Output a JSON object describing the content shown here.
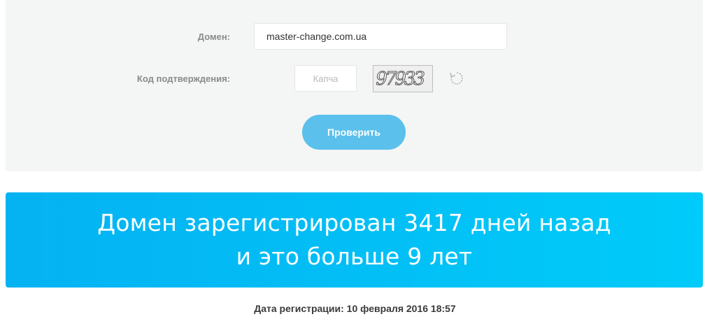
{
  "form": {
    "domain_label": "Домен:",
    "domain_value": "master-change.com.ua",
    "code_label": "Код подтверждения:",
    "captcha_placeholder": "Капча",
    "captcha_image_text": "97933",
    "refresh_icon": "refresh-icon",
    "submit_label": "Проверить"
  },
  "result": {
    "line1": "Домен зарегистрирован 3417 дней назад",
    "line2": "и это больше 9 лет",
    "registration_date": "Дата регистрации: 10 февраля 2016 18:57"
  },
  "colors": {
    "panel_bg": "#f4f5f5",
    "button": "#5bc0eb",
    "banner_from": "#05b2f2",
    "banner_to": "#00cbf9"
  }
}
